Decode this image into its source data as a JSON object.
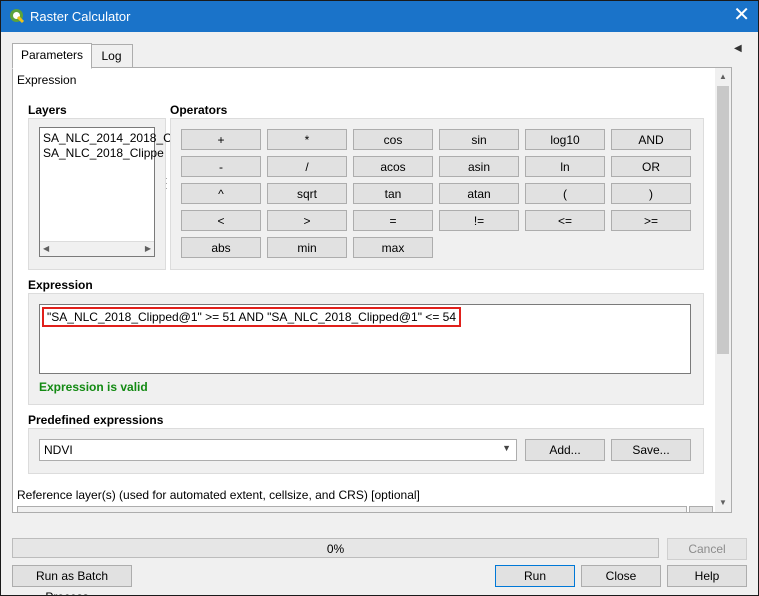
{
  "window": {
    "title": "Raster Calculator",
    "close_glyph": "✕",
    "collapse_glyph": "◀"
  },
  "tabs": [
    {
      "label": "Parameters"
    },
    {
      "label": "Log"
    }
  ],
  "section_label": "Expression",
  "layers": {
    "label": "Layers",
    "items": [
      "SA_NLC_2014_2018_C",
      "SA_NLC_2018_Clippe"
    ]
  },
  "operators": {
    "label": "Operators",
    "buttons": [
      [
        "+",
        "*",
        "cos",
        "sin",
        "log10",
        "AND"
      ],
      [
        "-",
        "/",
        "acos",
        "asin",
        "ln",
        "OR"
      ],
      [
        "^",
        "sqrt",
        "tan",
        "atan",
        "(",
        ")"
      ],
      [
        "<",
        ">",
        "=",
        "!=",
        "<=",
        ">="
      ],
      [
        "abs",
        "min",
        "max"
      ]
    ]
  },
  "expression": {
    "label": "Expression",
    "value": "\"SA_NLC_2018_Clipped@1\" >= 51 AND \"SA_NLC_2018_Clipped@1\" <= 54",
    "status": "Expression is valid",
    "highlight_color": "#e0201b",
    "status_color": "#138a13"
  },
  "predefined": {
    "label": "Predefined expressions",
    "selected": "NDVI",
    "add_label": "Add...",
    "save_label": "Save..."
  },
  "reference_layers_label": "Reference layer(s) (used for automated extent, cellsize, and CRS) [optional]",
  "progress": {
    "text": "0%",
    "value": 0
  },
  "footer": {
    "cancel": "Cancel",
    "batch": "Run as Batch Process...",
    "run": "Run",
    "close": "Close",
    "help": "Help"
  },
  "colors": {
    "titlebar": "#1a73c9",
    "focus_border": "#0078d7"
  }
}
